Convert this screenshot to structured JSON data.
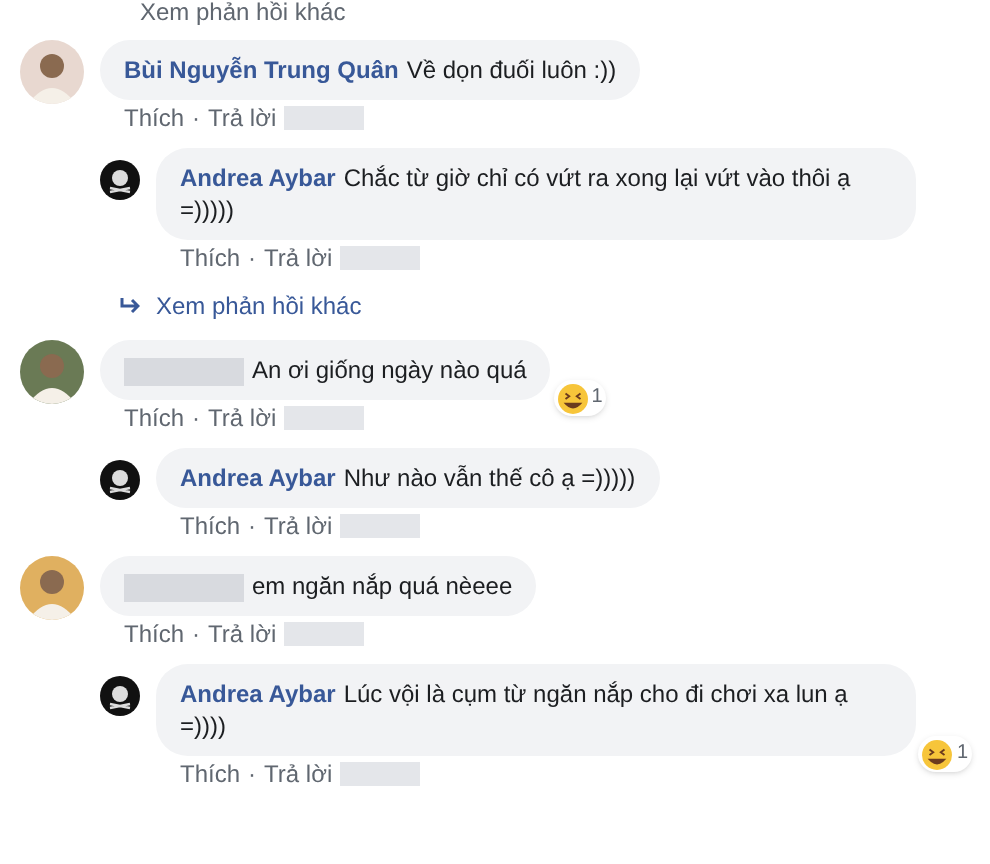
{
  "top_link": {
    "label": "Xem phản hồi khác"
  },
  "separator": "·",
  "comments": [
    {
      "author": "Bùi Nguyễn Trung Quân",
      "author_hidden": false,
      "text": "Về dọn đuối luôn :))",
      "actions": [
        "Thích",
        "Trả lời"
      ],
      "time_hidden": true,
      "replies": [
        {
          "author": "Andrea Aybar",
          "text": "Chắc từ giờ chỉ có vứt ra xong lại vứt vào thôi ạ =)))))",
          "actions": [
            "Thích",
            "Trả lời"
          ],
          "time_hidden": true
        }
      ],
      "more_replies": "Xem phản hồi khác"
    },
    {
      "author_hidden": true,
      "text": "An ơi giống ngày nào quá",
      "reaction": {
        "count": "1"
      },
      "actions": [
        "Thích",
        "Trả lời"
      ],
      "time_hidden": true,
      "replies": [
        {
          "author": "Andrea Aybar",
          "text": "Như nào vẫn thế cô ạ =)))))",
          "actions": [
            "Thích",
            "Trả lời"
          ],
          "time_hidden": true
        }
      ]
    },
    {
      "author_hidden": true,
      "text": "em ngăn nắp quá nèeee",
      "actions": [
        "Thích",
        "Trả lời"
      ],
      "time_hidden": true,
      "replies": [
        {
          "author": "Andrea Aybar",
          "text": "Lúc vội là cụm từ ngăn nắp cho đi chơi xa lun ạ =))))",
          "reaction": {
            "count": "1"
          },
          "actions": [
            "Thích",
            "Trả lời"
          ],
          "time_hidden": true
        }
      ]
    }
  ]
}
